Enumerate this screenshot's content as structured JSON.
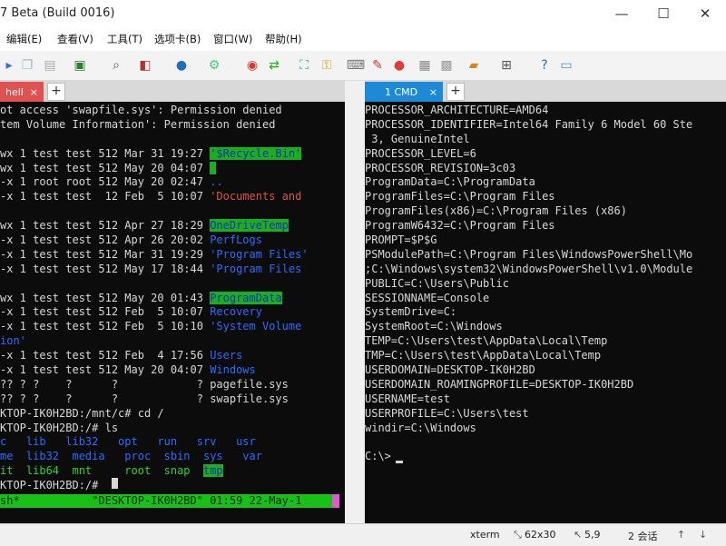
{
  "window": {
    "title": "7 Beta (Build 0016)",
    "minimize_glyph": "—",
    "maximize_glyph": "☐",
    "close_glyph": "✕"
  },
  "menu": [
    "编辑(E)",
    "查看(V)",
    "工具(T)",
    "选项卡(B)",
    "窗口(W)",
    "帮助(H)"
  ],
  "tabs": {
    "left": {
      "label": "hell",
      "close": "×"
    },
    "right": {
      "label": "1 CMD",
      "close": "×"
    },
    "add": "+"
  },
  "left_terminal": [
    [
      {
        "t": "ot access 'swapfile.sys': Permission denied"
      }
    ],
    [
      {
        "t": "tem Volume Information': Permission denied"
      }
    ],
    [
      {
        "t": ""
      }
    ],
    [
      {
        "t": "wx 1 test test 512 Mar 31 19:27 "
      },
      {
        "t": "'$Recycle.Bin'",
        "c": "hl"
      }
    ],
    [
      {
        "t": "wx 1 test test 512 May 20 04:07 "
      },
      {
        "t": " ",
        "c": "hl"
      }
    ],
    [
      {
        "t": "-x 1 root root 512 May 20 02:47 "
      },
      {
        "t": "..",
        "c": "blue"
      }
    ],
    [
      {
        "t": "-x 1 test test  12 Feb  5 10:07 "
      },
      {
        "t": "'Documents and ",
        "c": "red"
      }
    ],
    [
      {
        "t": ""
      }
    ],
    [
      {
        "t": "wx 1 test test 512 Apr 27 18:29 "
      },
      {
        "t": "OneDriveTemp",
        "c": "hl"
      }
    ],
    [
      {
        "t": "-x 1 test test 512 Apr 26 20:02 "
      },
      {
        "t": "PerfLogs",
        "c": "blue"
      }
    ],
    [
      {
        "t": "-x 1 test test 512 Mar 31 19:29 "
      },
      {
        "t": "'Program Files'",
        "c": "blue"
      }
    ],
    [
      {
        "t": "-x 1 test test 512 May 17 18:44 "
      },
      {
        "t": "'Program Files",
        "c": "blue"
      }
    ],
    [
      {
        "t": ""
      }
    ],
    [
      {
        "t": "wx 1 test test 512 May 20 01:43 "
      },
      {
        "t": "ProgramData",
        "c": "hl"
      }
    ],
    [
      {
        "t": "-x 1 test test 512 Feb  5 10:07 "
      },
      {
        "t": "Recovery",
        "c": "blue"
      }
    ],
    [
      {
        "t": "-x 1 test test 512 Feb  5 10:10 "
      },
      {
        "t": "'System Volume",
        "c": "blue"
      }
    ],
    [
      {
        "t": "ion'",
        "c": "blue"
      }
    ],
    [
      {
        "t": "-x 1 test test 512 Feb  4 17:56 "
      },
      {
        "t": "Users",
        "c": "blue"
      }
    ],
    [
      {
        "t": "-x 1 test test 512 May 20 04:07 "
      },
      {
        "t": "Windows",
        "c": "blue"
      }
    ],
    [
      {
        "t": "?? ? ?    ?      ?            ? pagefile.sys"
      }
    ],
    [
      {
        "t": "?? ? ?    ?      ?            ? swapfile.sys"
      }
    ],
    [
      {
        "t": "KTOP-IK0H2BD:/mnt/c# cd /"
      }
    ],
    [
      {
        "t": "KTOP-IK0H2BD:/# ls"
      }
    ],
    [
      {
        "t": "c   lib   lib32   opt   run   srv   usr",
        "c": "blue"
      }
    ],
    [
      {
        "t": "me  lib32  media   proc  sbin  sys   var",
        "c": "blue"
      }
    ],
    [
      {
        "t": "it  lib64  mnt     root  snap  ",
        "c": "green"
      },
      {
        "t": "tmp",
        "c": "hl"
      }
    ],
    [
      {
        "t": "KTOP-IK0H2BD:/#"
      }
    ]
  ],
  "left_statusline": "sh*           \"DESKTOP-IK0H2BD\" 01:59 22-May-1",
  "right_terminal": [
    "PROCESSOR_ARCHITECTURE=AMD64",
    "PROCESSOR_IDENTIFIER=Intel64 Family 6 Model 60 Ste",
    " 3, GenuineIntel",
    "PROCESSOR_LEVEL=6",
    "PROCESSOR_REVISION=3c03",
    "ProgramData=C:\\ProgramData",
    "ProgramFiles=C:\\Program Files",
    "ProgramFiles(x86)=C:\\Program Files (x86)",
    "ProgramW6432=C:\\Program Files",
    "PROMPT=$P$G",
    "PSModulePath=C:\\Program Files\\WindowsPowerShell\\Mo",
    ";C:\\Windows\\system32\\WindowsPowerShell\\v1.0\\Module",
    "PUBLIC=C:\\Users\\Public",
    "SESSIONNAME=Console",
    "SystemDrive=C:",
    "SystemRoot=C:\\Windows",
    "TEMP=C:\\Users\\test\\AppData\\Local\\Temp",
    "TMP=C:\\Users\\test\\AppData\\Local\\Temp",
    "USERDOMAIN=DESKTOP-IK0H2BD",
    "USERDOMAIN_ROAMINGPROFILE=DESKTOP-IK0H2BD",
    "USERNAME=test",
    "USERPROFILE=C:\\Users\\test",
    "windir=C:\\Windows",
    "",
    "C:\\>"
  ],
  "status": {
    "terminal_type": "xterm",
    "size": "62x30",
    "cursor": "5,9",
    "sessions": "2 会话"
  },
  "colors": {
    "accent_tab": "#1e8ad6",
    "left_tab": "#e05252",
    "highlight_bg": "#1bb01b",
    "statusline_bg": "#18c018"
  }
}
